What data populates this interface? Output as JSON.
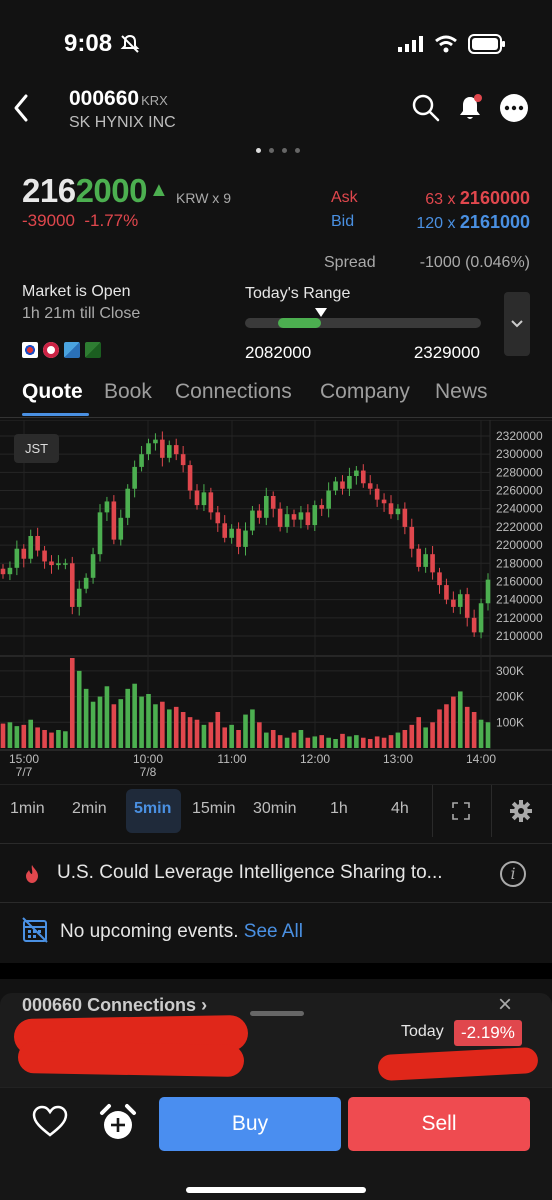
{
  "status_bar": {
    "time": "9:08"
  },
  "header": {
    "ticker": "000660",
    "exchange": "KRX",
    "company": "SK HYNIX INC"
  },
  "quote": {
    "price_prefix": "216",
    "price_suffix": "2000",
    "arrow": "▲",
    "currency_size": "KRW x 9",
    "change": "-39000",
    "change_pct": "-1.77%",
    "ask_label": "Ask",
    "ask_size": "63 x ",
    "ask_price": "2160000",
    "bid_label": "Bid",
    "bid_size": "120 x ",
    "bid_price": "2161000",
    "spread_label": "Spread",
    "spread_value": "-1000 (0.046%)"
  },
  "market": {
    "status": "Market is Open",
    "close_time": "1h 21m till Close"
  },
  "range": {
    "label": "Today's Range",
    "low": "2082000",
    "high": "2329000",
    "fill_start_frac": 0.14,
    "fill_end_frac": 0.32,
    "marker_frac": 0.32
  },
  "tabs": [
    "Quote",
    "Book",
    "Connections",
    "Company",
    "News"
  ],
  "chart_data": {
    "type": "candlestick",
    "timezone_badge": "JST",
    "price_ticks": [
      "2320000",
      "2300000",
      "2280000",
      "2260000",
      "2240000",
      "2220000",
      "2200000",
      "2180000",
      "2160000",
      "2140000",
      "2120000",
      "2100000"
    ],
    "volume_ticks": [
      "300K",
      "200K",
      "100K"
    ],
    "time_ticks": [
      {
        "t": "15:00",
        "d": "7/7"
      },
      {
        "t": "10:00",
        "d": "7/8"
      },
      {
        "t": "11:00",
        "d": ""
      },
      {
        "t": "12:00",
        "d": ""
      },
      {
        "t": "13:00",
        "d": ""
      },
      {
        "t": "14:00",
        "d": ""
      }
    ],
    "up_color": "#4caf50",
    "down_color": "#e0474d",
    "closes": [
      2168000,
      2175000,
      2196000,
      2185000,
      2210000,
      2194000,
      2182000,
      2178000,
      2180000,
      2180000,
      2132000,
      2152000,
      2164000,
      2190000,
      2236000,
      2248000,
      2206000,
      2230000,
      2262000,
      2286000,
      2300000,
      2312000,
      2316000,
      2296000,
      2310000,
      2300000,
      2288000,
      2260000,
      2244000,
      2258000,
      2236000,
      2224000,
      2208000,
      2218000,
      2198000,
      2216000,
      2238000,
      2230000,
      2254000,
      2240000,
      2220000,
      2234000,
      2228000,
      2236000,
      2222000,
      2244000,
      2240000,
      2260000,
      2270000,
      2262000,
      2276000,
      2282000,
      2268000,
      2262000,
      2250000,
      2246000,
      2234000,
      2240000,
      2220000,
      2196000,
      2176000,
      2190000,
      2170000,
      2156000,
      2140000,
      2132000,
      2146000,
      2120000,
      2104000,
      2136000,
      2162000
    ],
    "volumes": [
      95000,
      100000,
      85000,
      90000,
      110000,
      80000,
      70000,
      60000,
      70000,
      65000,
      350000,
      300000,
      230000,
      180000,
      200000,
      240000,
      170000,
      190000,
      230000,
      250000,
      200000,
      210000,
      170000,
      180000,
      150000,
      160000,
      140000,
      120000,
      110000,
      90000,
      100000,
      140000,
      80000,
      90000,
      70000,
      130000,
      150000,
      100000,
      60000,
      70000,
      50000,
      40000,
      60000,
      70000,
      40000,
      45000,
      50000,
      40000,
      35000,
      55000,
      45000,
      50000,
      40000,
      35000,
      45000,
      40000,
      50000,
      60000,
      70000,
      90000,
      120000,
      80000,
      100000,
      150000,
      170000,
      200000,
      220000,
      160000,
      140000,
      110000,
      100000
    ]
  },
  "timeframes": [
    "1min",
    "2min",
    "5min",
    "15min",
    "30min",
    "1h",
    "4h"
  ],
  "news": {
    "headline": "U.S. Could Leverage Intelligence Sharing to..."
  },
  "events": {
    "text": "No upcoming events. ",
    "link": "See All"
  },
  "sheet": {
    "title": "000660 Connections ›",
    "today_label": "Today",
    "today_pct": "-2.19%"
  },
  "actions": {
    "buy": "Buy",
    "sell": "Sell"
  }
}
